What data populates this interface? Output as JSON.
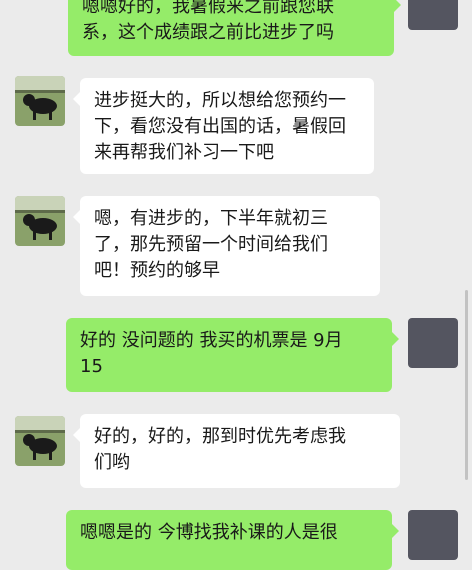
{
  "messages": [
    {
      "side": "out",
      "lines": [
        "嗯嗯好的，我暑假来之前跟您联",
        "系，这个成绩跟之前比进步了吗"
      ]
    },
    {
      "side": "in",
      "lines": [
        "进步挺大的，所以想给您预约一",
        "下，看您没有出国的话，暑假回",
        "来再帮我们补习一下吧"
      ]
    },
    {
      "side": "in",
      "lines": [
        "嗯，有进步的，下半年就初三",
        "了，那先预留一个时间给我们",
        "吧！预约的够早"
      ]
    },
    {
      "side": "out",
      "lines": [
        "好的 没问题的 我买的机票是 9月",
        "15"
      ]
    },
    {
      "side": "in",
      "lines": [
        "好的，好的，那到时优先考虑我",
        "们哟"
      ]
    },
    {
      "side": "out",
      "lines": [
        "嗯嗯是的 今博找我补课的人是很"
      ]
    }
  ],
  "colors": {
    "background": "#ebebeb",
    "incoming_bubble": "#ffffff",
    "outgoing_bubble": "#95ec69",
    "my_avatar": "#545560"
  },
  "icons": {
    "contact_avatar": "dog-avatar",
    "my_avatar": "dark-square-avatar"
  }
}
